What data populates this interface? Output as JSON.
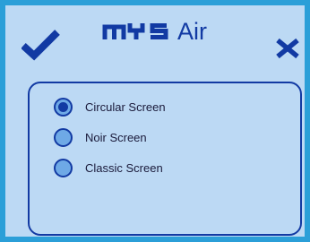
{
  "header": {
    "logo_brand": "MYS",
    "logo_product": "Air",
    "confirm_icon": "checkmark-icon",
    "close_icon": "close-x-icon"
  },
  "colors": {
    "frame_border": "#2b9fd8",
    "background": "#bcd9f4",
    "accent": "#123aa3",
    "radio_fill": "#6ea9e6"
  },
  "options": [
    {
      "label": "Circular Screen",
      "selected": true
    },
    {
      "label": "Noir Screen",
      "selected": false
    },
    {
      "label": "Classic Screen",
      "selected": false
    }
  ]
}
